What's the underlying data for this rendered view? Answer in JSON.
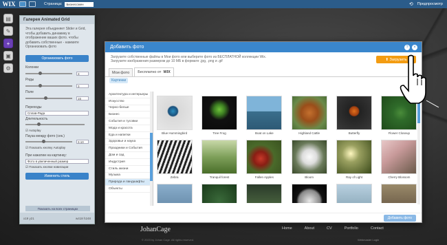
{
  "topbar": {
    "logo": "WIX",
    "page_label": "Страница:",
    "page_value": "Бизнессмен",
    "preview": "Предпросмотр",
    "undo": "⟲"
  },
  "panel": {
    "title": "Галерея Animated Grid",
    "description": "Эта галерея объединяет Slider и Grid, чтобы добавить динамику в отображение ваших фото. чтобы добавить собственные - нажмите Организовать фото",
    "organize_button": "Организовать фото",
    "rows": [
      {
        "label": "Колонки",
        "value": "3"
      },
      {
        "label": "Ряды",
        "value": "3"
      },
      {
        "label": "Поле",
        "value": "15"
      }
    ],
    "transition_label": "Переходы",
    "transition_value": "Сплав-Рада",
    "duration_label": "Длительность",
    "autoplay_label": "Autoplay",
    "pause_label": "Пауза между фото (сек.)",
    "pause_value": "3.10",
    "show_autoplay": "Показать кнопку Autoplay",
    "on_click_label": "При нажатии на картинку:",
    "on_click_value": "Фото в увеличенный размер",
    "show_nav": "Показать кнопки навигации",
    "change_styles": "Изменить стиль",
    "show_all_pages": "Показать на всех страницах",
    "foot_left": "x19   y21",
    "foot_right": "w418   h248"
  },
  "modal": {
    "title": "Добавить фото",
    "help": "?",
    "close": "×",
    "info_line1": "Загрузите собственные файлы в Мои фото или выберите фото из БЕСПЛАТНОЙ коллекции Wix.",
    "info_line2": "Загрузите изображения размером до 10 МБ в формате .jpg, .png и .gif",
    "upload_button": "Загрузить",
    "tabs": [
      {
        "label": "Мои фото"
      },
      {
        "label": "Бесплатно от"
      }
    ],
    "tab_brand": "WIX",
    "chip": "Картинки",
    "categories": [
      "Архитектура и интерьеры",
      "Искусство",
      "Черно-белые",
      "Бизнес",
      "События и тусовки",
      "Мода и красота",
      "Еда и напитки",
      "Здоровье и наука",
      "Праздники и События",
      "Дом и сад",
      "Индустрия",
      "Стиль жизни",
      "Музыка",
      "Природа и ландшафты",
      "Объекты"
    ],
    "selected_category": "Природа и ландшафты",
    "photos": [
      {
        "caption": "Blue Hummingbird",
        "icon": "hummingbird-photo"
      },
      {
        "caption": "Tree Frog",
        "icon": "frog-photo"
      },
      {
        "caption": "Boat on Lake",
        "icon": "boat-photo"
      },
      {
        "caption": "Highland Cattle",
        "icon": "cattle-photo"
      },
      {
        "caption": "Butterfly",
        "icon": "butterfly-photo"
      },
      {
        "caption": "Flower Closeup",
        "icon": "flower-photo"
      },
      {
        "caption": "Zebra",
        "icon": "zebra-photo"
      },
      {
        "caption": "Tranquil forest",
        "icon": "forest-photo"
      },
      {
        "caption": "Fallen Apples",
        "icon": "apples-photo"
      },
      {
        "caption": "Bloom",
        "icon": "bloom-photo"
      },
      {
        "caption": "Ray of Light",
        "icon": "light-photo"
      },
      {
        "caption": "Cherry Blossom",
        "icon": "blossom-photo"
      },
      {
        "caption": "",
        "icon": "photo"
      },
      {
        "caption": "",
        "icon": "photo"
      },
      {
        "caption": "",
        "icon": "photo"
      },
      {
        "caption": "",
        "icon": "photo"
      },
      {
        "caption": "",
        "icon": "photo"
      },
      {
        "caption": "",
        "icon": "photo"
      }
    ],
    "add_button": "Добавить фото"
  },
  "site": {
    "name": "JohanCage",
    "nav": [
      "Home",
      "About",
      "CV",
      "Portfolio",
      "Contact"
    ],
    "copyright": "© 2023 by Johan Cage. All rights reserved.",
    "login": "Webmaster Login"
  }
}
